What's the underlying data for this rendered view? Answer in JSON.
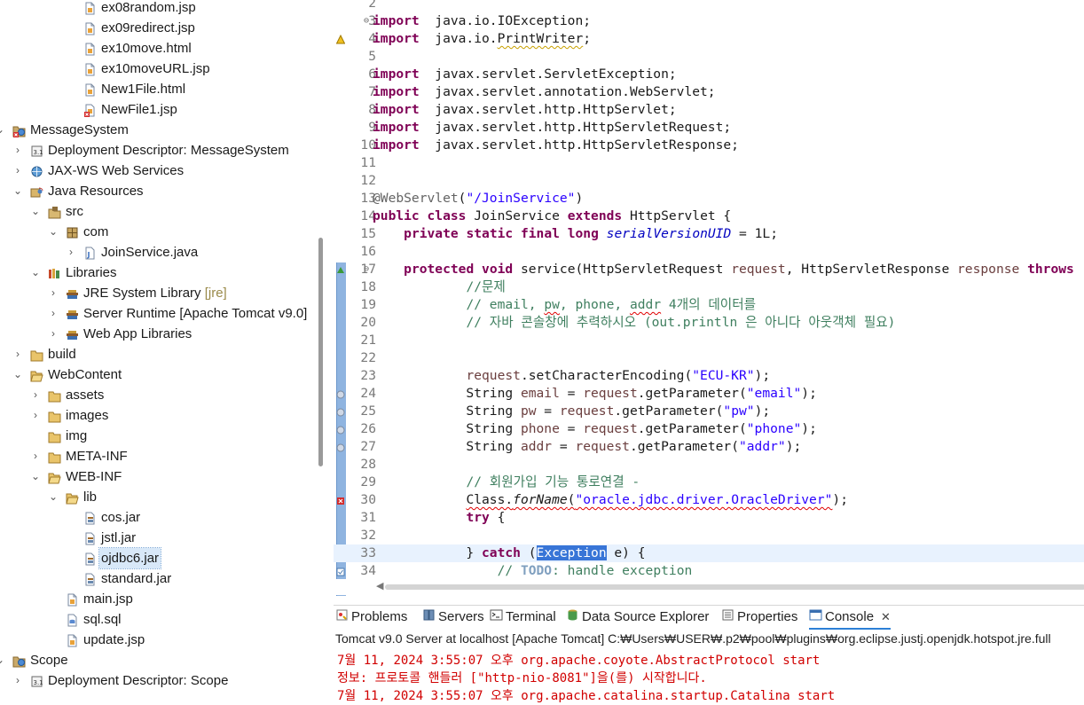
{
  "explorer": {
    "items": [
      {
        "label": "ex08random.jsp",
        "icon": "jsp-file-icon",
        "depth": 4,
        "twisty": ""
      },
      {
        "label": "ex09redirect.jsp",
        "icon": "jsp-file-icon",
        "depth": 4,
        "twisty": ""
      },
      {
        "label": "ex10move.html",
        "icon": "html-file-icon",
        "depth": 4,
        "twisty": ""
      },
      {
        "label": "ex10moveURL.jsp",
        "icon": "jsp-file-icon",
        "depth": 4,
        "twisty": ""
      },
      {
        "label": "New1File.html",
        "icon": "html-file-icon",
        "depth": 4,
        "twisty": ""
      },
      {
        "label": "NewFile1.jsp",
        "icon": "jsp-error-file-icon",
        "depth": 4,
        "twisty": ""
      },
      {
        "label": "MessageSystem",
        "icon": "web-project-error-icon",
        "depth": 0,
        "twisty": "expanded"
      },
      {
        "label": "Deployment Descriptor: MessageSystem",
        "icon": "deployment-descriptor-icon",
        "depth": 1,
        "twisty": "collapsed"
      },
      {
        "label": "JAX-WS Web Services",
        "icon": "web-services-icon",
        "depth": 1,
        "twisty": "collapsed"
      },
      {
        "label": "Java Resources",
        "icon": "java-resources-icon",
        "depth": 1,
        "twisty": "expanded"
      },
      {
        "label": "src",
        "icon": "source-folder-icon",
        "depth": 2,
        "twisty": "expanded"
      },
      {
        "label": "com",
        "icon": "package-icon",
        "depth": 3,
        "twisty": "expanded"
      },
      {
        "label": "JoinService.java",
        "icon": "java-file-icon",
        "depth": 4,
        "twisty": "collapsed"
      },
      {
        "label": "Libraries",
        "icon": "libraries-icon",
        "depth": 2,
        "twisty": "expanded"
      },
      {
        "label": "JRE System Library",
        "decor": "[jre]",
        "icon": "library-icon",
        "depth": 3,
        "twisty": "collapsed"
      },
      {
        "label": "Server Runtime [Apache Tomcat v9.0]",
        "icon": "library-icon",
        "depth": 3,
        "twisty": "collapsed"
      },
      {
        "label": "Web App Libraries",
        "icon": "library-icon",
        "depth": 3,
        "twisty": "collapsed"
      },
      {
        "label": "build",
        "icon": "folder-icon",
        "depth": 1,
        "twisty": "collapsed"
      },
      {
        "label": "WebContent",
        "icon": "folder-open-icon",
        "depth": 1,
        "twisty": "expanded"
      },
      {
        "label": "assets",
        "icon": "folder-icon",
        "depth": 2,
        "twisty": "collapsed"
      },
      {
        "label": "images",
        "icon": "folder-icon",
        "depth": 2,
        "twisty": "collapsed"
      },
      {
        "label": "img",
        "icon": "folder-icon",
        "depth": 2,
        "twisty": ""
      },
      {
        "label": "META-INF",
        "icon": "folder-icon",
        "depth": 2,
        "twisty": "collapsed"
      },
      {
        "label": "WEB-INF",
        "icon": "folder-open-icon",
        "depth": 2,
        "twisty": "expanded"
      },
      {
        "label": "lib",
        "icon": "folder-open-icon",
        "depth": 3,
        "twisty": "expanded"
      },
      {
        "label": "cos.jar",
        "icon": "jar-file-icon",
        "depth": 4,
        "twisty": ""
      },
      {
        "label": "jstl.jar",
        "icon": "jar-file-icon",
        "depth": 4,
        "twisty": ""
      },
      {
        "label": "ojdbc6.jar",
        "icon": "jar-file-icon",
        "depth": 4,
        "twisty": "",
        "selected": true
      },
      {
        "label": "standard.jar",
        "icon": "jar-file-icon",
        "depth": 4,
        "twisty": ""
      },
      {
        "label": "main.jsp",
        "icon": "jsp-file-icon",
        "depth": 3,
        "twisty": ""
      },
      {
        "label": "sql.sql",
        "icon": "sql-file-icon",
        "depth": 3,
        "twisty": ""
      },
      {
        "label": "update.jsp",
        "icon": "jsp-file-icon",
        "depth": 3,
        "twisty": ""
      },
      {
        "label": "Scope",
        "icon": "web-project-icon",
        "depth": 0,
        "twisty": "expanded"
      },
      {
        "label": "Deployment Descriptor: Scope",
        "icon": "deployment-descriptor-icon",
        "depth": 1,
        "twisty": "collapsed"
      }
    ]
  },
  "editor": {
    "lines": [
      {
        "n": "2",
        "segs": []
      },
      {
        "n": "3",
        "fold": "⊖",
        "segs": [
          [
            "kw",
            "import"
          ],
          [
            "",
            "  java.io.IOException;"
          ]
        ]
      },
      {
        "n": "4",
        "marker": "warning",
        "segs": [
          [
            "kw",
            "import"
          ],
          [
            "",
            "  java.io."
          ],
          [
            "squig",
            "PrintWriter"
          ],
          [
            "",
            ";"
          ]
        ]
      },
      {
        "n": "5",
        "segs": []
      },
      {
        "n": "6",
        "segs": [
          [
            "kw",
            "import"
          ],
          [
            "",
            "  javax.servlet.ServletException;"
          ]
        ]
      },
      {
        "n": "7",
        "segs": [
          [
            "kw",
            "import"
          ],
          [
            "",
            "  javax.servlet.annotation.WebServlet;"
          ]
        ]
      },
      {
        "n": "8",
        "segs": [
          [
            "kw",
            "import"
          ],
          [
            "",
            "  javax.servlet.http.HttpServlet;"
          ]
        ]
      },
      {
        "n": "9",
        "segs": [
          [
            "kw",
            "import"
          ],
          [
            "",
            "  javax.servlet.http.HttpServletRequest;"
          ]
        ]
      },
      {
        "n": "10",
        "segs": [
          [
            "kw",
            "import"
          ],
          [
            "",
            "  javax.servlet.http.HttpServletResponse;"
          ]
        ]
      },
      {
        "n": "11",
        "segs": []
      },
      {
        "n": "12",
        "segs": []
      },
      {
        "n": "13",
        "segs": [
          [
            "ann",
            "@WebServlet"
          ],
          [
            "",
            "("
          ],
          [
            "str",
            "\"/JoinService\""
          ],
          [
            "",
            ")"
          ]
        ]
      },
      {
        "n": "14",
        "segs": [
          [
            "kw",
            "public"
          ],
          [
            "",
            " "
          ],
          [
            "kw",
            "class"
          ],
          [
            "",
            " JoinService "
          ],
          [
            "kw",
            "extends"
          ],
          [
            "",
            " HttpServlet {"
          ]
        ]
      },
      {
        "n": "15",
        "segs": [
          [
            "",
            "    "
          ],
          [
            "kw",
            "private"
          ],
          [
            "",
            " "
          ],
          [
            "kw",
            "static"
          ],
          [
            "",
            " "
          ],
          [
            "kw",
            "final"
          ],
          [
            "",
            " "
          ],
          [
            "kw",
            "long"
          ],
          [
            "",
            " "
          ],
          [
            "fld",
            "serialVersionUID"
          ],
          [
            "",
            " = 1L;"
          ]
        ]
      },
      {
        "n": "16",
        "segs": []
      },
      {
        "n": "17",
        "fold": "⊖",
        "marker": "override",
        "segs": [
          [
            "",
            "    "
          ],
          [
            "kw",
            "protected"
          ],
          [
            "",
            " "
          ],
          [
            "kw",
            "void"
          ],
          [
            "",
            " service(HttpServletRequest "
          ],
          [
            "var",
            "request"
          ],
          [
            "",
            ", HttpServletResponse "
          ],
          [
            "var",
            "response"
          ],
          [
            "",
            " "
          ],
          [
            "kw",
            "throws"
          ]
        ]
      },
      {
        "n": "18",
        "segs": [
          [
            "",
            "            "
          ],
          [
            "cm",
            "//문제"
          ]
        ]
      },
      {
        "n": "19",
        "segs": [
          [
            "",
            "            "
          ],
          [
            "cm",
            "// email, "
          ],
          [
            "cm squig-red",
            "pw"
          ],
          [
            "cm",
            ", phone, "
          ],
          [
            "cm squig-red",
            "addr"
          ],
          [
            "cm",
            " 4개의 데이터를"
          ]
        ]
      },
      {
        "n": "20",
        "segs": [
          [
            "",
            "            "
          ],
          [
            "cm",
            "// 자바 콘솔창에 추력하시오 (out.println 은 아니다 아웃객체 필요)"
          ]
        ]
      },
      {
        "n": "21",
        "segs": []
      },
      {
        "n": "22",
        "segs": []
      },
      {
        "n": "23",
        "segs": [
          [
            "",
            "            "
          ],
          [
            "var",
            "request"
          ],
          [
            "",
            ".setCharacterEncoding("
          ],
          [
            "str",
            "\"ECU-KR\""
          ],
          [
            "",
            ");"
          ]
        ]
      },
      {
        "n": "24",
        "marker": "info",
        "segs": [
          [
            "",
            "            String "
          ],
          [
            "var",
            "email"
          ],
          [
            "",
            " = "
          ],
          [
            "var",
            "request"
          ],
          [
            "",
            ".getParameter("
          ],
          [
            "str",
            "\"email\""
          ],
          [
            "",
            ");"
          ]
        ]
      },
      {
        "n": "25",
        "marker": "info",
        "segs": [
          [
            "",
            "            String "
          ],
          [
            "var",
            "pw"
          ],
          [
            "",
            " = "
          ],
          [
            "var",
            "request"
          ],
          [
            "",
            ".getParameter("
          ],
          [
            "str",
            "\"pw\""
          ],
          [
            "",
            ");"
          ]
        ]
      },
      {
        "n": "26",
        "marker": "info",
        "segs": [
          [
            "",
            "            String "
          ],
          [
            "var",
            "phone"
          ],
          [
            "",
            " = "
          ],
          [
            "var",
            "request"
          ],
          [
            "",
            ".getParameter("
          ],
          [
            "str",
            "\"phone\""
          ],
          [
            "",
            ");"
          ]
        ]
      },
      {
        "n": "27",
        "marker": "info",
        "segs": [
          [
            "",
            "            String "
          ],
          [
            "var",
            "addr"
          ],
          [
            "",
            " = "
          ],
          [
            "var",
            "request"
          ],
          [
            "",
            ".getParameter("
          ],
          [
            "str",
            "\"addr\""
          ],
          [
            "",
            ");"
          ]
        ]
      },
      {
        "n": "28",
        "segs": []
      },
      {
        "n": "29",
        "segs": [
          [
            "",
            "            "
          ],
          [
            "cm",
            "// 회원가입 기능 통로연결 -"
          ]
        ]
      },
      {
        "n": "30",
        "marker": "error",
        "segs": [
          [
            "",
            "            "
          ],
          [
            "squig-red",
            "Class."
          ],
          [
            "squig-red smeth",
            "forName"
          ],
          [
            "squig-red",
            "("
          ],
          [
            "str squig-red",
            "\"oracle.jdbc.driver.OracleDriver\""
          ],
          [
            "",
            ");"
          ]
        ]
      },
      {
        "n": "31",
        "segs": [
          [
            "",
            "            "
          ],
          [
            "kw",
            "try"
          ],
          [
            "",
            " {"
          ]
        ]
      },
      {
        "n": "32",
        "segs": []
      },
      {
        "n": "33",
        "current": true,
        "segs": [
          [
            "",
            "            } "
          ],
          [
            "kw",
            "catch"
          ],
          [
            "",
            " ("
          ],
          [
            "hl",
            "Exception"
          ],
          [
            "",
            " e) {"
          ]
        ]
      },
      {
        "n": "34",
        "marker": "task",
        "segs": [
          [
            "",
            "                "
          ],
          [
            "cm",
            "// "
          ],
          [
            "todo",
            "TODO"
          ],
          [
            "cm",
            ": handle exception"
          ]
        ]
      }
    ]
  },
  "panel": {
    "tabs": [
      {
        "label": "Problems",
        "icon": "problems-icon"
      },
      {
        "label": "Servers",
        "icon": "servers-icon"
      },
      {
        "label": "Terminal",
        "icon": "terminal-icon"
      },
      {
        "label": "Data Source Explorer",
        "icon": "data-source-icon"
      },
      {
        "label": "Properties",
        "icon": "properties-icon"
      },
      {
        "label": "Console",
        "icon": "console-icon",
        "active": true,
        "close": "✕"
      }
    ],
    "console_title": "Tomcat v9.0 Server at localhost [Apache Tomcat] C:₩Users₩USER₩.p2₩pool₩plugins₩org.eclipse.justj.openjdk.hotspot.jre.full",
    "lines": [
      "7월 11, 2024 3:55:07 오후 org.apache.coyote.AbstractProtocol start",
      "정보: 프로토콜 핸들러 [\"http-nio-8081\"]을(를) 시작합니다.",
      "7월 11, 2024 3:55:07 오후 org.apache.catalina.startup.Catalina start"
    ]
  },
  "colors": {
    "keyword": "#7f0055",
    "string": "#2a00ff",
    "comment": "#3f7f5f",
    "console_error": "#d10000",
    "selection": "#3875d7"
  }
}
